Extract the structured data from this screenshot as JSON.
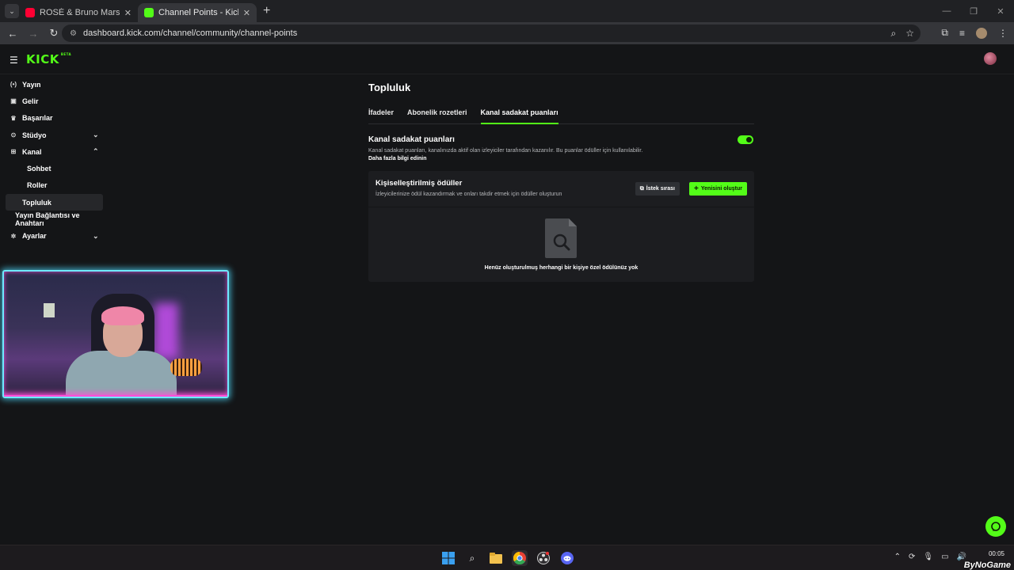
{
  "browser": {
    "tabs": [
      {
        "title": "ROSÉ & Bruno Mars - APT. (Offi",
        "favicon_color": "#ff0033"
      },
      {
        "title": "Channel Points - Kick Dashboa",
        "favicon_color": "#53fc18"
      }
    ],
    "url": "dashboard.kick.com/channel/community/channel-points"
  },
  "header": {
    "logo": "KICK",
    "logo_badge": "BETA"
  },
  "sidebar": {
    "items": [
      {
        "label": "Yayın",
        "icon": "broadcast-icon"
      },
      {
        "label": "Gelir",
        "icon": "wallet-icon"
      },
      {
        "label": "Başarılar",
        "icon": "trophy-icon"
      },
      {
        "label": "Stüdyo",
        "icon": "studio-icon"
      },
      {
        "label": "Kanal",
        "icon": "channel-icon"
      }
    ],
    "kanal_sub": [
      "Sohbet",
      "Roller",
      "Topluluk"
    ],
    "stream_key": "Yayın Bağlantısı ve Anahtarı",
    "settings": "Ayarlar"
  },
  "main": {
    "title": "Topluluk",
    "tabs": [
      "İfadeler",
      "Abonelik rozetleri",
      "Kanal sadakat puanları"
    ],
    "loyalty": {
      "heading": "Kanal sadakat puanları",
      "description": "Kanal sadakat puanları, kanalınızda aktif olan izleyiciler tarafından kazanılır. Bu puanlar ödüller için kullanılabilir.",
      "learn_more": "Daha fazla bilgi edinin",
      "enabled": true
    },
    "rewards": {
      "heading": "Kişiselleştirilmiş ödüller",
      "description": "İzleyicilerinize ödül kazandırmak ve onları takdir etmek için ödüller oluşturun",
      "queue_button": "İstek sırası",
      "create_button": "Yenisini oluştur",
      "empty_text": "Henüz oluşturulmuş herhangi bir kişiye özel ödülünüz yok"
    }
  },
  "taskbar": {
    "time": "00:05"
  },
  "watermark": "ByNoGame",
  "colors": {
    "accent": "#53fc18",
    "background": "#141517",
    "card": "#1c1d20"
  }
}
